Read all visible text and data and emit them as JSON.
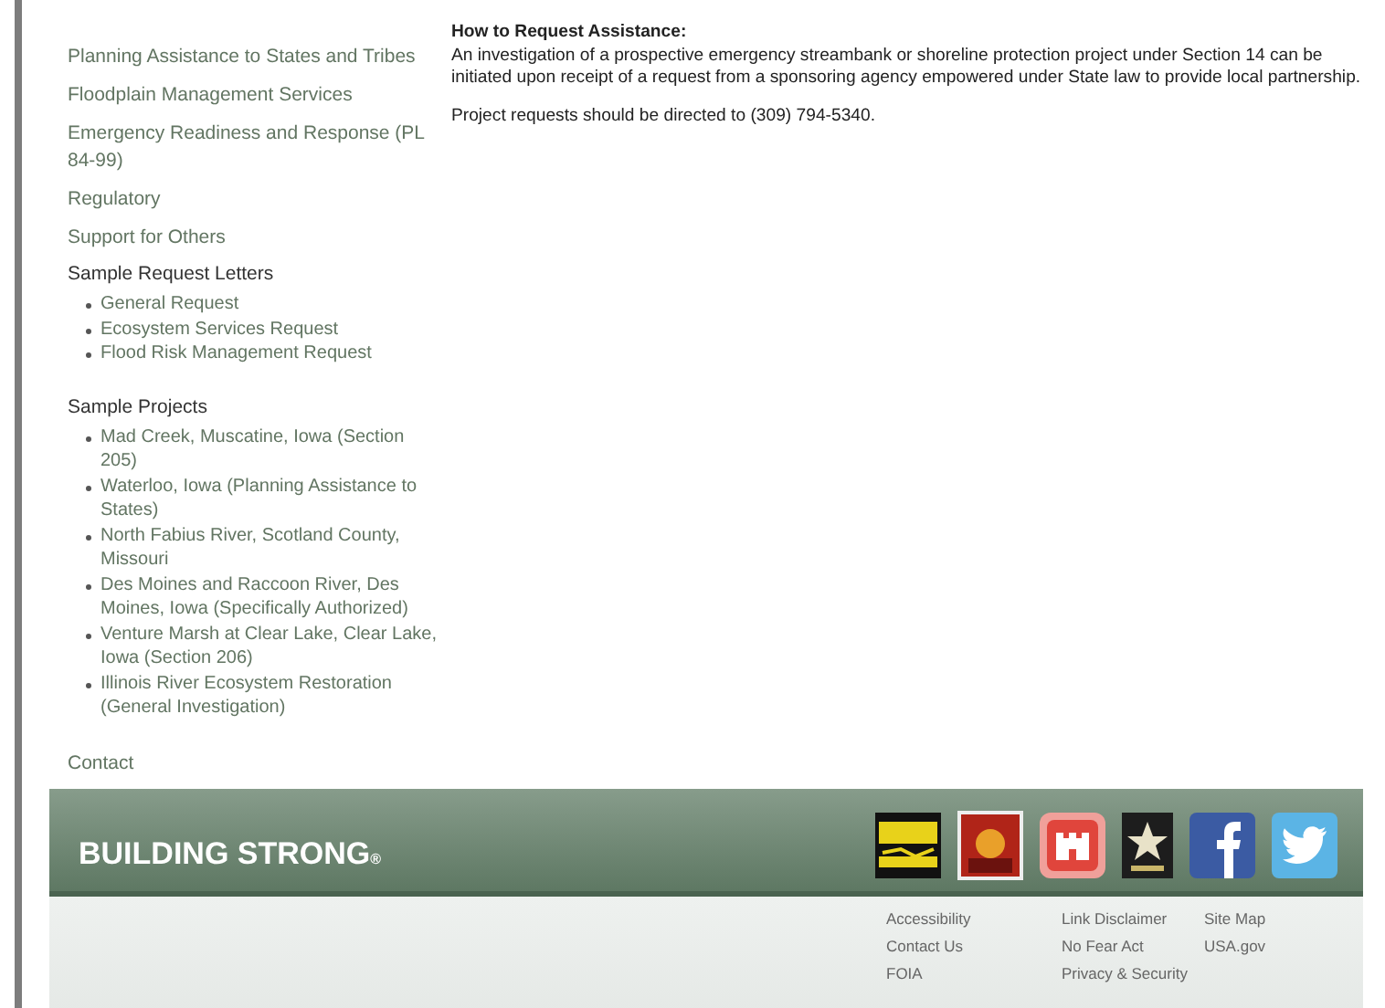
{
  "sidebar": {
    "links": [
      {
        "label": "Planning Assistance to States and Tribes"
      },
      {
        "label": "Floodplain Management Services"
      },
      {
        "label": "Emergency Readiness and Response (PL 84-99)"
      },
      {
        "label": "Regulatory"
      },
      {
        "label": "Support for Others"
      }
    ],
    "sections": [
      {
        "heading": "Sample Request Letters",
        "items": [
          "General Request",
          "Ecosystem Services Request",
          "Flood Risk Management Request"
        ]
      },
      {
        "heading": "Sample Projects",
        "items": [
          "Mad Creek, Muscatine, Iowa (Section 205)",
          "Waterloo, Iowa (Planning Assistance to States)",
          "North Fabius River, Scotland County, Missouri",
          "Des Moines and Raccoon River, Des Moines, Iowa (Specifically Authorized)",
          "Venture Marsh at Clear Lake, Clear Lake, Iowa (Section 206)",
          "Illinois River Ecosystem Restoration (General Investigation)"
        ]
      }
    ],
    "contact": "Contact"
  },
  "main": {
    "heading": "How to Request Assistance:",
    "paragraphs": [
      "An investigation of a prospective emergency streambank or shoreline protection project under Section 14 can be initiated upon receipt of a request from a sponsoring agency empowered under State law to provide local partnership.",
      "Project requests should be directed to (309) 794-5340."
    ]
  },
  "footer": {
    "brand": "BUILDING STRONG",
    "brand_mark": "®",
    "logos": [
      {
        "kind": "sharp"
      },
      {
        "kind": "salute"
      },
      {
        "kind": "castle"
      },
      {
        "kind": "army"
      },
      {
        "kind": "facebook"
      },
      {
        "kind": "twitter"
      }
    ],
    "link_columns": [
      [
        "Accessibility",
        "Contact Us",
        "FOIA"
      ],
      [
        "Link Disclaimer",
        "No Fear Act",
        "Privacy & Security"
      ],
      [
        "Site Map",
        "USA.gov"
      ]
    ]
  }
}
